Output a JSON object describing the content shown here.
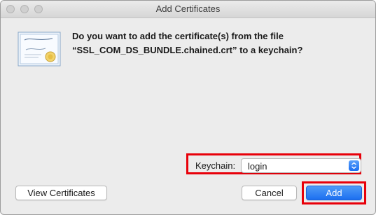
{
  "window": {
    "title": "Add Certificates"
  },
  "dialog": {
    "message_line1": "Do you want to add the certificate(s) from the file",
    "message_line2": "“SSL_COM_DS_BUNDLE.chained.crt” to a keychain?",
    "icon": "certificate-icon"
  },
  "keychain": {
    "label": "Keychain:",
    "selected": "login"
  },
  "buttons": {
    "view": "View Certificates",
    "cancel": "Cancel",
    "add": "Add"
  },
  "colors": {
    "highlight": "#e8000a",
    "accent": "#1c6ff0"
  }
}
